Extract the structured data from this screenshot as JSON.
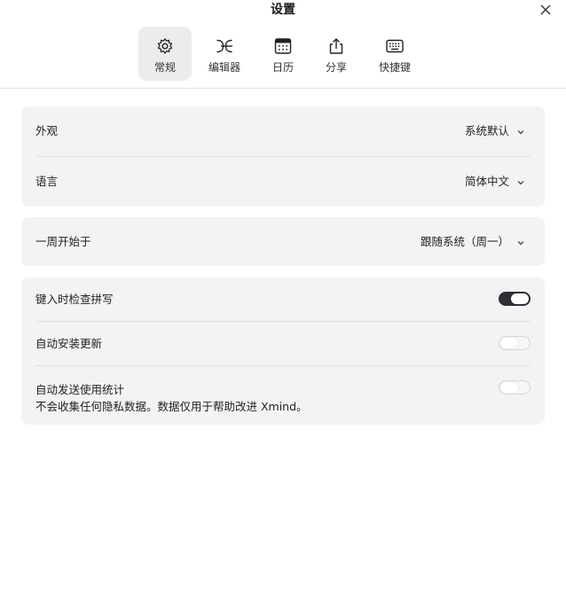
{
  "window": {
    "title": "设置"
  },
  "tabs": [
    {
      "label": "常规",
      "icon": "gear-icon",
      "active": true
    },
    {
      "label": "编辑器",
      "icon": "editor-icon",
      "active": false
    },
    {
      "label": "日历",
      "icon": "calendar-icon",
      "active": false
    },
    {
      "label": "分享",
      "icon": "share-icon",
      "active": false
    },
    {
      "label": "快捷键",
      "icon": "keyboard-icon",
      "active": false
    }
  ],
  "appearance": {
    "label": "外观",
    "value": "系统默认"
  },
  "language": {
    "label": "语言",
    "value": "简体中文"
  },
  "week_start": {
    "label": "一周开始于",
    "value": "跟随系统（周一）"
  },
  "spellcheck": {
    "label": "键入时检查拼写",
    "enabled": true
  },
  "auto_update": {
    "label": "自动安装更新",
    "enabled": false
  },
  "usage_stats": {
    "label": "自动发送使用统计",
    "description": "不会收集任何隐私数据。数据仅用于帮助改进 Xmind。",
    "enabled": false
  },
  "colors": {
    "toggle_on": "#2e2e33",
    "card_bg": "#f3f3f5",
    "active_tab_bg": "#ececee"
  }
}
